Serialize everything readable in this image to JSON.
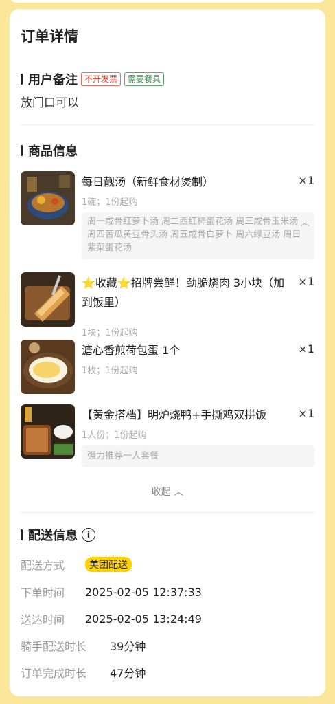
{
  "order": {
    "title": "订单详情",
    "remark": {
      "heading": "用户备注",
      "tags": [
        "不开发票",
        "需要餐具"
      ],
      "text": "放门口可以"
    },
    "products": {
      "heading": "商品信息",
      "items": [
        {
          "name": "每日靓汤（新鲜食材煲制）",
          "qty": "×1",
          "spec": "1碗；1份起购",
          "desc": "周一咸骨红萝卜汤 周二西红柿蛋花汤 周三咸骨玉米汤 周四苦瓜黄豆骨头汤 周五咸骨白萝卜 周六绿豆汤 周日紫菜蛋花汤"
        },
        {
          "name": "⭐收藏⭐招牌尝鲜！劲脆烧肉 3小块（加到饭里）",
          "qty": "×1",
          "spec": "1块；1份起购"
        },
        {
          "name": "溏心香煎荷包蛋 1个",
          "qty": "×1",
          "spec": "1枚；1份起购"
        },
        {
          "name": "【黄金搭档】明炉烧鸭+手撕鸡双拼饭",
          "qty": "×1",
          "spec": "1人份；1份起购",
          "desc": "强力推荐一人套餐"
        }
      ],
      "collapse_label": "收起"
    },
    "delivery": {
      "heading": "配送信息",
      "method_label": "配送方式",
      "method_value": "美团配送",
      "order_time_label": "下单时间",
      "order_time_value": "2025-02-05 12:37:33",
      "arrive_time_label": "送达时间",
      "arrive_time_value": "2025-02-05 13:24:49",
      "rider_duration_label": "骑手配送时长",
      "rider_duration_value": "39分钟",
      "complete_duration_label": "订单完成时长",
      "complete_duration_value": "47分钟"
    }
  }
}
